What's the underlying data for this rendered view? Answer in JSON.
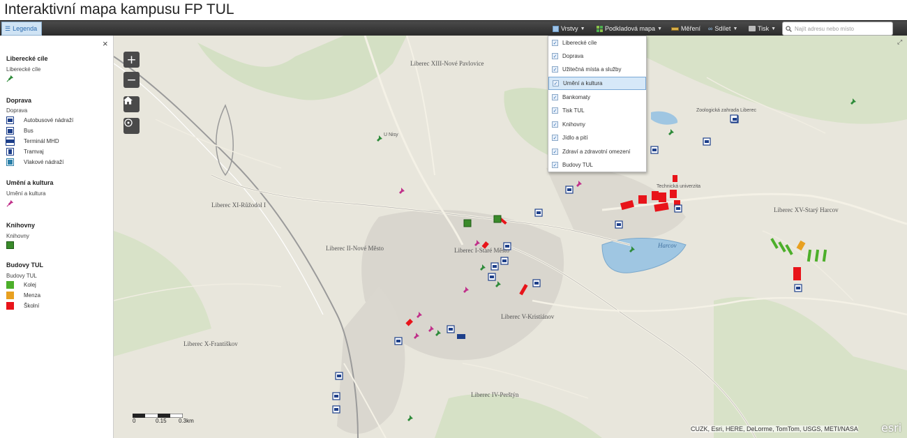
{
  "title": "Interaktivní mapa kampusu FP TUL",
  "toolbar": {
    "legend_label": "Legenda",
    "layers_label": "Vrstvy",
    "basemap_label": "Podkladová mapa",
    "measure_label": "Měření",
    "share_label": "Sdílet",
    "print_label": "Tisk",
    "search_placeholder": "Najít adresu nebo místo"
  },
  "legend": {
    "close_label": "×",
    "groups": [
      {
        "title": "Liberecké cíle",
        "sub": "Liberecké cíle"
      },
      {
        "title": "Doprava",
        "sub": "Doprava",
        "items": [
          "Autobusové nádraží",
          "Bus",
          "Terminál MHD",
          "Tramvaj",
          "Vlakové nádraží"
        ]
      },
      {
        "title": "Umění a kultura",
        "sub": "Umění a kultura"
      },
      {
        "title": "Knihovny",
        "sub": "Knihovny"
      },
      {
        "title": "Budovy TUL",
        "sub": "Budovy TUL",
        "items": [
          "Kolej",
          "Menza",
          "Školní"
        ]
      }
    ],
    "colors": {
      "kolej": "#4caf2a",
      "menza": "#e8a020",
      "skolni": "#e8141a",
      "transport": "#1d3f8a",
      "library": "#3a8a2a",
      "art": "#c0308a",
      "target": "#2e8b3a"
    }
  },
  "layers_menu": {
    "items": [
      {
        "label": "Liberecké cíle",
        "checked": true
      },
      {
        "label": "Doprava",
        "checked": true
      },
      {
        "label": "Užitečná místa a služby",
        "checked": true
      },
      {
        "label": "Umění a kultura",
        "checked": true
      },
      {
        "label": "Bankomaty",
        "checked": true
      },
      {
        "label": "Tisk TUL",
        "checked": true
      },
      {
        "label": "Knihovny",
        "checked": true
      },
      {
        "label": "Jídlo a pití",
        "checked": true
      },
      {
        "label": "Zdraví a zdravotní omezení",
        "checked": true
      },
      {
        "label": "Budovy TUL",
        "checked": true
      }
    ],
    "active_index": 3
  },
  "map": {
    "zoom_in": "+",
    "zoom_out": "−",
    "places": [
      {
        "name": "Liberec XIII-Nové Pavlovice"
      },
      {
        "name": "Liberec XI-Růžodol I"
      },
      {
        "name": "Liberec II-Nové Město"
      },
      {
        "name": "Liberec I-Staré Město"
      },
      {
        "name": "Liberec V-Kristiánov"
      },
      {
        "name": "Liberec X-Františkov"
      },
      {
        "name": "Liberec IV-Perštýn"
      },
      {
        "name": "Liberec XV-Starý Harcov"
      },
      {
        "name": "Harcov"
      },
      {
        "name": "Zoologická zahrada Liberec"
      },
      {
        "name": "U Nisy"
      },
      {
        "name": "Technická univerzita"
      }
    ],
    "scale": {
      "zero": "0",
      "mid": "0.15",
      "end": "0.3km"
    },
    "attribution": "CUZK, Esri, HERE, DeLorme, TomTom, USGS, METI/NASA",
    "esri": "esri"
  }
}
